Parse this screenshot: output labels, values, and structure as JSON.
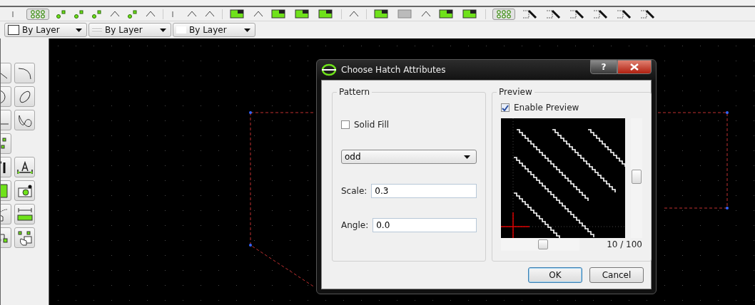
{
  "property_bar": {
    "combos": [
      {
        "kind": "color",
        "value": "By Layer"
      },
      {
        "kind": "line",
        "value": "By Layer"
      },
      {
        "kind": "width",
        "value": "By Layer"
      }
    ]
  },
  "dialog": {
    "title": "Choose Hatch Attributes",
    "help_button": "?",
    "pattern": {
      "title": "Pattern",
      "solid_fill": {
        "label": "Solid Fill",
        "checked": false
      },
      "pattern_name": "odd",
      "scale": {
        "label": "Scale:",
        "value": "0.3"
      },
      "angle": {
        "label": "Angle:",
        "value": "0.0"
      }
    },
    "preview": {
      "title": "Preview",
      "enable_preview": {
        "label": "Enable Preview",
        "checked": true
      },
      "zoom_reading": "10 / 100"
    },
    "buttons": [
      {
        "label": "OK",
        "kind": "default"
      },
      {
        "label": "Cancel",
        "kind": "normal"
      }
    ]
  }
}
